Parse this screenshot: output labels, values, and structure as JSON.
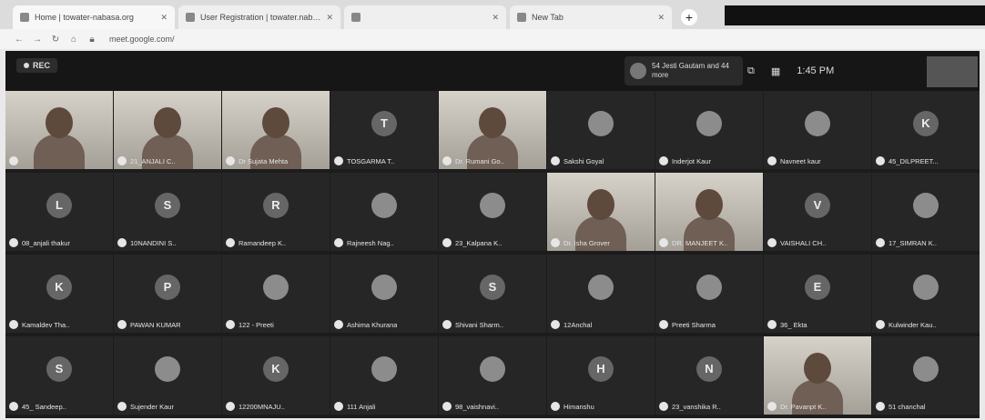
{
  "browser": {
    "tabs": [
      {
        "title": "Home | towater-nabasa.org"
      },
      {
        "title": "User Registration | towater.nabas"
      },
      {
        "title": ""
      },
      {
        "title": "New Tab"
      }
    ],
    "new_tab": "+",
    "url": "meet.google.com/"
  },
  "meet": {
    "rec_label": "REC",
    "pinned_text": "54 Jesti Gautam and 44 more",
    "time": "1:45 PM",
    "tiles": [
      {
        "name": "",
        "type": "video"
      },
      {
        "name": "21_ANJALI C..",
        "type": "video"
      },
      {
        "name": "Dr Sujata Mehta",
        "type": "video"
      },
      {
        "name": "TOSGARMA T..",
        "type": "letter",
        "letter": "T"
      },
      {
        "name": "Dr. Rumani Go..",
        "type": "video"
      },
      {
        "name": "Sakshi Goyal",
        "type": "photo"
      },
      {
        "name": "Inderjot Kaur",
        "type": "photo"
      },
      {
        "name": "Navneet kaur",
        "type": "photo"
      },
      {
        "name": "45_DILPREET...",
        "type": "letter",
        "letter": "K"
      },
      {
        "name": "08_anjali thakur",
        "type": "letter",
        "letter": "L"
      },
      {
        "name": "10NANDINI S..",
        "type": "letter",
        "letter": "S"
      },
      {
        "name": "Ramandeep K..",
        "type": "letter",
        "letter": "R"
      },
      {
        "name": "Rajneesh Nag..",
        "type": "photo"
      },
      {
        "name": "23_Kalpana K..",
        "type": "photo"
      },
      {
        "name": "Dr. Isha Grover",
        "type": "video"
      },
      {
        "name": "DR. MANJEET K..",
        "type": "video"
      },
      {
        "name": "VAISHALI CH..",
        "type": "letter",
        "letter": "V"
      },
      {
        "name": "17_SIMRAN K..",
        "type": "photo"
      },
      {
        "name": "Kamaldev Tha..",
        "type": "letter",
        "letter": "K"
      },
      {
        "name": "PAWAN KUMAR",
        "type": "letter",
        "letter": "P"
      },
      {
        "name": "122 - Preeti",
        "type": "photo"
      },
      {
        "name": "Ashima Khurana",
        "type": "photo"
      },
      {
        "name": "Shivani Sharm..",
        "type": "letter",
        "letter": "S"
      },
      {
        "name": "12Anchal",
        "type": "photo"
      },
      {
        "name": "Preeti Sharma",
        "type": "photo"
      },
      {
        "name": "36_ Ekta",
        "type": "letter",
        "letter": "E"
      },
      {
        "name": "Kulwinder Kau..",
        "type": "photo"
      },
      {
        "name": "45_ Sandeep..",
        "type": "letter",
        "letter": "S"
      },
      {
        "name": "Sujender Kaur",
        "type": "photo"
      },
      {
        "name": "12200MNAJU..",
        "type": "letter",
        "letter": "K"
      },
      {
        "name": "111 Anjali",
        "type": "photo"
      },
      {
        "name": "98_vaishnavi..",
        "type": "photo"
      },
      {
        "name": "Himanshu",
        "type": "letter",
        "letter": "H"
      },
      {
        "name": "23_vanshika R..",
        "type": "letter",
        "letter": "N"
      },
      {
        "name": "Dr. Pavanpt K..",
        "type": "video"
      },
      {
        "name": "51 chanchal",
        "type": "photo"
      }
    ]
  }
}
